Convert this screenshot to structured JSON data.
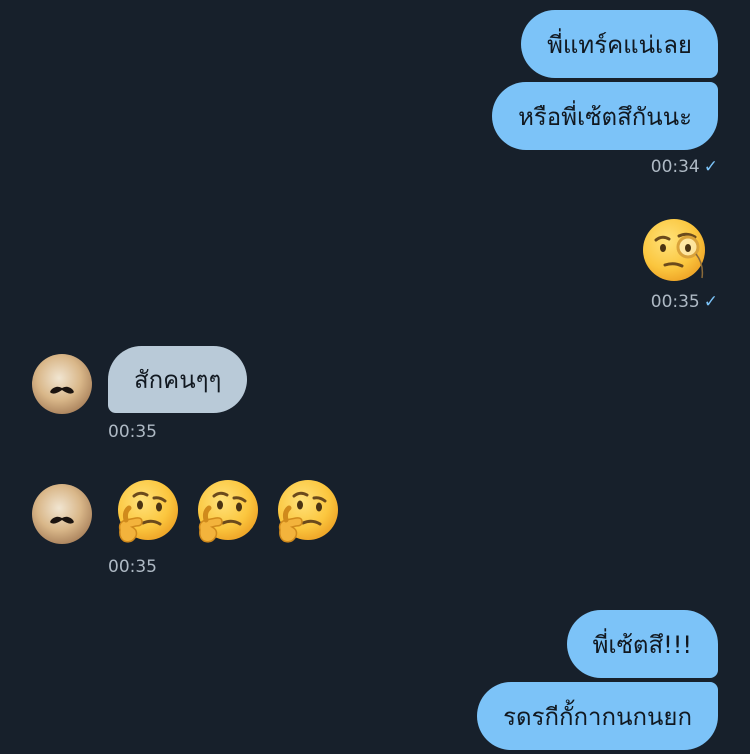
{
  "chat": {
    "messages": [
      {
        "id": "m1",
        "text": "พี่แทร์คแน่เลย"
      },
      {
        "id": "m2",
        "text": "หรือพี่เซ้ตสึกันนะ",
        "time": "00:34"
      },
      {
        "id": "m3",
        "emoji": "face-with-monocle",
        "time": "00:35"
      },
      {
        "id": "m4",
        "text": "สักคนๆๆ",
        "time": "00:35"
      },
      {
        "id": "m5",
        "emoji": [
          "thinking-face",
          "thinking-face",
          "thinking-face"
        ],
        "time": "00:35"
      },
      {
        "id": "m6",
        "text": "พี่เซ้ตสึ!!!"
      },
      {
        "id": "m7",
        "text": "รดรกีกั้กากนกนยก"
      }
    ],
    "read_tick": "✓",
    "colors": {
      "background": "#17202b",
      "outgoing_bubble": "#7cc3f8",
      "incoming_bubble": "#b9cad8",
      "timestamp": "#aeb9c4"
    }
  }
}
